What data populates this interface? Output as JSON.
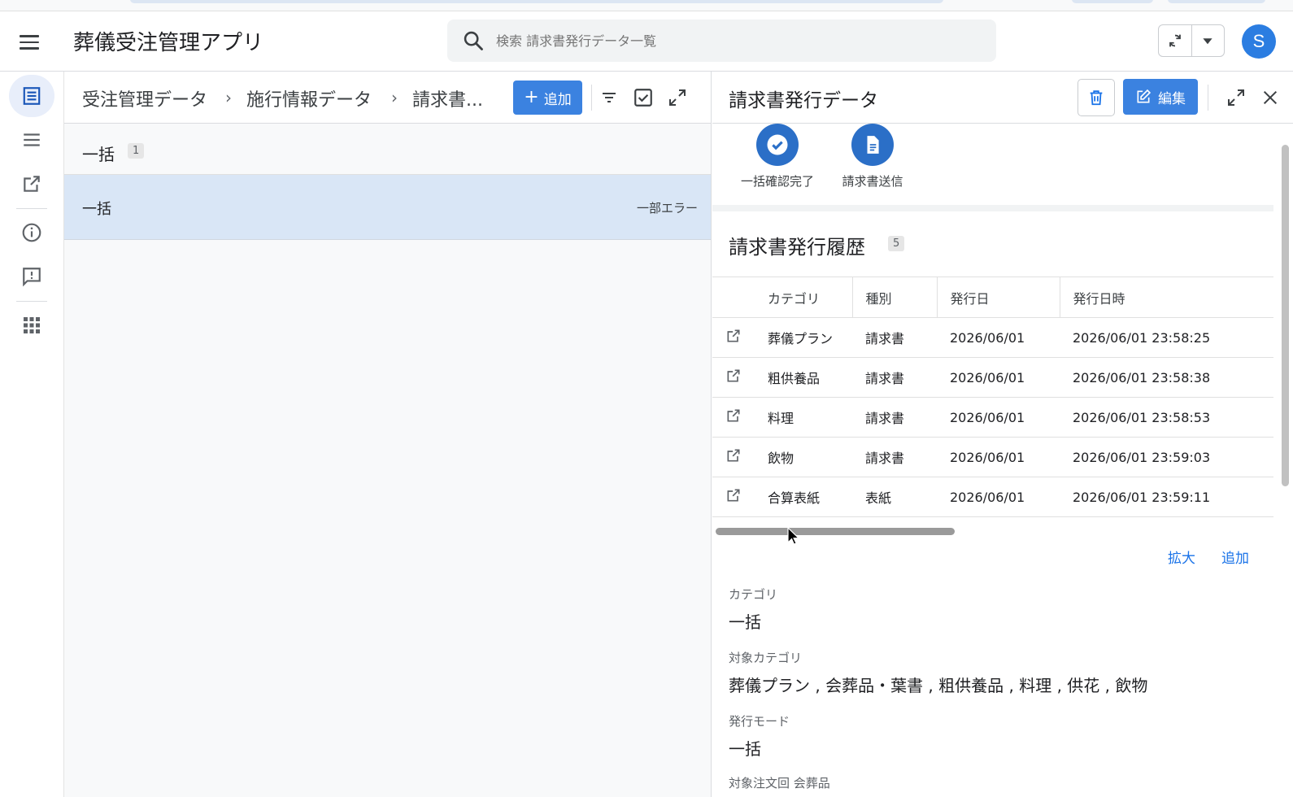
{
  "app": {
    "title": "葬儀受注管理アプリ",
    "avatar_letter": "S"
  },
  "search": {
    "placeholder": "検索 請求書発行データ一覧"
  },
  "breadcrumb": {
    "items": [
      "受注管理データ",
      "施行情報データ",
      "請求書..."
    ]
  },
  "left_panel": {
    "add_label": "追加",
    "group": {
      "title": "一括",
      "count": "1"
    },
    "selected_row": {
      "title": "一括",
      "status": "一部エラー"
    }
  },
  "detail": {
    "title": "請求書発行データ",
    "edit_label": "編集",
    "actions": [
      {
        "label": "一括確認完了",
        "icon": "check-circle-icon"
      },
      {
        "label": "請求書送信",
        "icon": "document-icon"
      }
    ],
    "history": {
      "title": "請求書発行履歴",
      "count": "5",
      "columns": [
        "カテゴリ",
        "種別",
        "発行日",
        "発行日時"
      ],
      "rows": [
        [
          "葬儀プラン",
          "請求書",
          "2026/06/01",
          "2026/06/01 23:58:25"
        ],
        [
          "粗供養品",
          "請求書",
          "2026/06/01",
          "2026/06/01 23:58:38"
        ],
        [
          "料理",
          "請求書",
          "2026/06/01",
          "2026/06/01 23:58:53"
        ],
        [
          "飲物",
          "請求書",
          "2026/06/01",
          "2026/06/01 23:59:03"
        ],
        [
          "合算表紙",
          "表紙",
          "2026/06/01",
          "2026/06/01 23:59:11"
        ]
      ],
      "links": {
        "expand": "拡大",
        "add": "追加"
      }
    },
    "fields": [
      {
        "label": "カテゴリ",
        "value": "一括"
      },
      {
        "label": "対象カテゴリ",
        "value": "葬儀プラン , 会葬品・葉書 , 粗供養品 , 料理 , 供花 , 飲物"
      },
      {
        "label": "発行モード",
        "value": "一括"
      },
      {
        "label": "対象注文回 会葬品",
        "value": ""
      }
    ]
  },
  "colors": {
    "accent": "#3b82e0",
    "selected_row": "#d9e6f6",
    "action_circle": "#2b6fc7"
  }
}
